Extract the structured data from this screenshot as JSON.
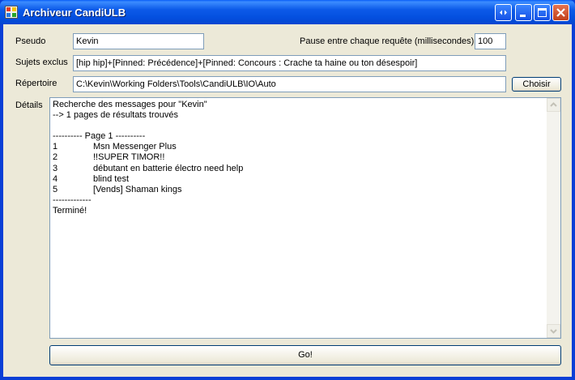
{
  "window": {
    "title": "Archiveur CandiULB"
  },
  "form": {
    "pseudo_label": "Pseudo",
    "pseudo_value": "Kevin",
    "pause_label": "Pause entre chaque requête (millisecondes)",
    "pause_value": "100",
    "excluded_label": "Sujets exclus",
    "excluded_value": "[hip hip]+[Pinned:  Précédence]+[Pinned:  Concours : Crache ta haine ou ton désespoir]",
    "directory_label": "Répertoire",
    "directory_value": "C:\\Kevin\\Working Folders\\Tools\\CandiULB\\IO\\Auto",
    "choose_button": "Choisir",
    "details_label": "Détails",
    "go_button": "Go!"
  },
  "details": {
    "line1": "Recherche des messages pour \"Kevin\"",
    "line2": "--> 1 pages de résultats trouvés",
    "page_header": "---------- Page 1 ----------",
    "results": [
      {
        "num": "1",
        "title": "Msn Messenger Plus"
      },
      {
        "num": "2",
        "title": "!!SUPER TIMOR!!"
      },
      {
        "num": "3",
        "title": "débutant en batterie électro need help"
      },
      {
        "num": "4",
        "title": "blind test"
      },
      {
        "num": "5",
        "title": "[Vends] Shaman kings"
      }
    ],
    "separator": "-------------",
    "done": "Terminé!"
  },
  "icons": {
    "app": "app-icon",
    "restore": "restore-icon",
    "minimize": "minimize-icon",
    "maximize": "maximize-icon",
    "close": "close-icon",
    "scroll_up": "scroll-up-arrow-icon",
    "scroll_down": "scroll-down-arrow-icon"
  },
  "colors": {
    "titlebar": "#0450e0",
    "client_bg": "#ece9d8",
    "textbox_border": "#7f9db9",
    "close_button": "#c2401a"
  }
}
